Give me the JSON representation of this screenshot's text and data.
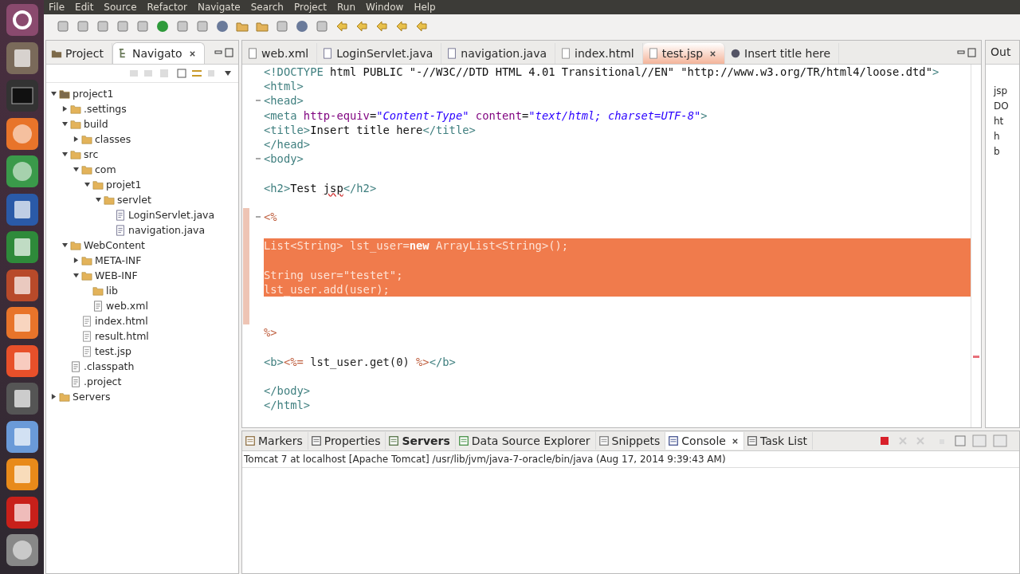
{
  "menu": [
    "File",
    "Edit",
    "Source",
    "Refactor",
    "Navigate",
    "Search",
    "Project",
    "Run",
    "Window",
    "Help"
  ],
  "left_panel": {
    "tabs": [
      {
        "label": "Project",
        "selected": false,
        "kind": "project"
      },
      {
        "label": "Navigato",
        "selected": true,
        "kind": "navigator"
      }
    ],
    "tree": [
      {
        "label": "project1",
        "kind": "project",
        "expanded": true,
        "children": [
          {
            "label": ".settings",
            "kind": "folder",
            "expanded": false
          },
          {
            "label": "build",
            "kind": "folder",
            "expanded": true,
            "children": [
              {
                "label": "classes",
                "kind": "folder",
                "expanded": false
              }
            ]
          },
          {
            "label": "src",
            "kind": "folder",
            "expanded": true,
            "children": [
              {
                "label": "com",
                "kind": "folder",
                "expanded": true,
                "children": [
                  {
                    "label": "projet1",
                    "kind": "folder",
                    "expanded": true,
                    "children": [
                      {
                        "label": "servlet",
                        "kind": "folder",
                        "expanded": true,
                        "children": [
                          {
                            "label": "LoginServlet.java",
                            "kind": "java"
                          },
                          {
                            "label": "navigation.java",
                            "kind": "java"
                          }
                        ]
                      }
                    ]
                  }
                ]
              }
            ]
          },
          {
            "label": "WebContent",
            "kind": "folder",
            "expanded": true,
            "children": [
              {
                "label": "META-INF",
                "kind": "folder",
                "expanded": false
              },
              {
                "label": "WEB-INF",
                "kind": "folder",
                "expanded": true,
                "children": [
                  {
                    "label": "lib",
                    "kind": "folder"
                  },
                  {
                    "label": "web.xml",
                    "kind": "xml"
                  }
                ]
              },
              {
                "label": "index.html",
                "kind": "html"
              },
              {
                "label": "result.html",
                "kind": "html"
              },
              {
                "label": "test.jsp",
                "kind": "html"
              }
            ]
          },
          {
            "label": ".classpath",
            "kind": "xml"
          },
          {
            "label": ".project",
            "kind": "xml"
          }
        ]
      },
      {
        "label": "Servers",
        "kind": "folder",
        "expanded": false
      }
    ]
  },
  "editor": {
    "tabs": [
      {
        "label": "web.xml",
        "kind": "xml",
        "selected": false
      },
      {
        "label": "LoginServlet.java",
        "kind": "java",
        "selected": false
      },
      {
        "label": "navigation.java",
        "kind": "java",
        "selected": false
      },
      {
        "label": "index.html",
        "kind": "html",
        "selected": false
      },
      {
        "label": "test.jsp",
        "kind": "html",
        "selected": true
      },
      {
        "label": "Insert title here",
        "kind": "browser",
        "selected": false
      }
    ],
    "lines": [
      {
        "selected": false,
        "tokens": [
          {
            "kind": "tag",
            "text": "<!DOCTYPE"
          },
          {
            "kind": "text",
            "text": " html PUBLIC \"-//W3C//DTD HTML 4.01 Transitional//EN\" \"http://www.w3.org/TR/html4/loose.dtd\""
          },
          {
            "kind": "tag",
            "text": ">"
          }
        ]
      },
      {
        "selected": false,
        "tokens": [
          {
            "kind": "tag",
            "text": "<html>"
          }
        ]
      },
      {
        "selected": false,
        "foldable": true,
        "tokens": [
          {
            "kind": "tag",
            "text": "<head>"
          }
        ]
      },
      {
        "selected": false,
        "tokens": [
          {
            "kind": "tag",
            "text": "<meta"
          },
          {
            "kind": "attr",
            "text": " http-equiv"
          },
          {
            "kind": "text",
            "text": "="
          },
          {
            "kind": "value",
            "text": "\"Content-Type\""
          },
          {
            "kind": "attr",
            "text": " content"
          },
          {
            "kind": "text",
            "text": "="
          },
          {
            "kind": "value",
            "text": "\"text/html; charset=UTF-8\""
          },
          {
            "kind": "tag",
            "text": ">"
          }
        ]
      },
      {
        "selected": false,
        "tokens": [
          {
            "kind": "tag",
            "text": "<title>"
          },
          {
            "kind": "text",
            "text": "Insert title here"
          },
          {
            "kind": "tag",
            "text": "</title>"
          }
        ]
      },
      {
        "selected": false,
        "tokens": [
          {
            "kind": "tag",
            "text": "</head>"
          }
        ]
      },
      {
        "selected": false,
        "foldable": true,
        "tokens": [
          {
            "kind": "tag",
            "text": "<body>"
          }
        ]
      },
      {
        "selected": false
      },
      {
        "selected": false,
        "tokens": [
          {
            "kind": "tag",
            "text": "<h2>"
          },
          {
            "kind": "text",
            "text": "Test "
          },
          {
            "kind": "misspelled",
            "text": "jsp"
          },
          {
            "kind": "tag",
            "text": "</h2>"
          }
        ]
      },
      {
        "selected": false
      },
      {
        "selected": false,
        "foldable": true,
        "tokens": [
          {
            "kind": "jsp",
            "text": "<%"
          }
        ]
      },
      {
        "selected": false
      },
      {
        "selected": true,
        "tokens": [
          {
            "kind": "code",
            "text": "List<String> lst_user="
          },
          {
            "kind": "keyword",
            "text": "new"
          },
          {
            "kind": "code",
            "text": " ArrayList<String>();"
          }
        ]
      },
      {
        "selected": true
      },
      {
        "selected": true,
        "tokens": [
          {
            "kind": "code",
            "text": "String user=\"testet\";"
          }
        ]
      },
      {
        "selected": true,
        "tokens": [
          {
            "kind": "code",
            "text": "lst_user.add(user);"
          }
        ]
      },
      {
        "selected": false
      },
      {
        "selected": false
      },
      {
        "selected": false,
        "tokens": [
          {
            "kind": "jsp",
            "text": "%>"
          }
        ]
      },
      {
        "selected": false
      },
      {
        "selected": false,
        "tokens": [
          {
            "kind": "tag",
            "text": "<b>"
          },
          {
            "kind": "jsp",
            "text": "<%="
          },
          {
            "kind": "code",
            "text": " lst_user.get(0) "
          },
          {
            "kind": "jsp",
            "text": "%>"
          },
          {
            "kind": "tag",
            "text": "</b>"
          }
        ]
      },
      {
        "selected": false
      },
      {
        "selected": false,
        "tokens": [
          {
            "kind": "tag",
            "text": "</body>"
          }
        ]
      },
      {
        "selected": false,
        "tokens": [
          {
            "kind": "tag",
            "text": "</html>"
          }
        ]
      }
    ]
  },
  "outline": {
    "tab": "Out",
    "items": [
      "jsp",
      "DO",
      "ht",
      "h",
      "b"
    ]
  },
  "bottom_panel": {
    "tabs": [
      {
        "label": "Markers",
        "kind": "markers",
        "selected": false,
        "bold": false
      },
      {
        "label": "Properties",
        "kind": "properties",
        "selected": false,
        "bold": false
      },
      {
        "label": "Servers",
        "kind": "servers",
        "selected": false,
        "bold": true
      },
      {
        "label": "Data Source Explorer",
        "kind": "datasource",
        "selected": false,
        "bold": false
      },
      {
        "label": "Snippets",
        "kind": "snippets",
        "selected": false,
        "bold": false
      },
      {
        "label": "Console",
        "kind": "console",
        "selected": true,
        "bold": false
      },
      {
        "label": "Task List",
        "kind": "tasks",
        "selected": false,
        "bold": false
      }
    ],
    "console_title": "Tomcat 7 at localhost [Apache Tomcat] /usr/lib/jvm/java-7-oracle/bin/java (Aug 17, 2014 9:39:43 AM)"
  }
}
